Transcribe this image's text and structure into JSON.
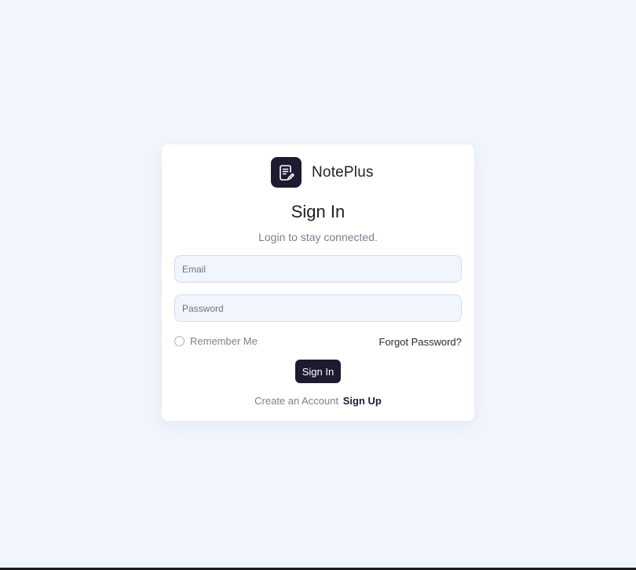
{
  "brand": {
    "name": "NotePlus",
    "logo_icon": "note-edit-icon"
  },
  "form": {
    "title": "Sign In",
    "subtitle": "Login to stay connected.",
    "email_placeholder": "Email",
    "password_placeholder": "Password",
    "remember_label": "Remember Me",
    "forgot_label": "Forgot Password?",
    "submit_label": "Sign In",
    "signup_prompt": "Create an Account",
    "signup_link": "Sign Up"
  },
  "colors": {
    "background": "#f1f5fe",
    "card": "#ffffff",
    "primary": "#1e1b30",
    "muted_text": "#7c7f90"
  }
}
